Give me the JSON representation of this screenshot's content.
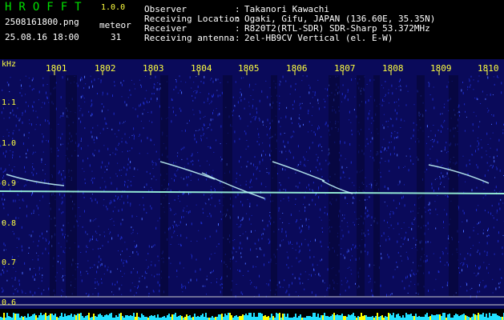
{
  "header": {
    "app_title": "HROFFT",
    "app_version": "1.0.0",
    "file_name": "2508161800.png",
    "meteor_label": "meteor",
    "timestamp": "25.08.16 18:00",
    "meteor_count": "31",
    "info": [
      {
        "key": "Observer",
        "value": "Takanori Kawachi"
      },
      {
        "key": "Receiving Location",
        "value": "Ogaki, Gifu, JAPAN (136.60E, 35.35N)"
      },
      {
        "key": "Receiver",
        "value": "R820T2(RTL-SDR) SDR-Sharp 53.372MHz"
      },
      {
        "key": "Receiving antenna",
        "value": "2el-HB9CV Vertical (el. E-W)"
      }
    ],
    "separator": ":"
  },
  "spectrogram": {
    "y_unit": "kHz",
    "y_ticks": [
      "1.1",
      "1.0",
      "0.9",
      "0.8",
      "0.7",
      "0.6"
    ],
    "x_ticks": [
      "1801",
      "1802",
      "1803",
      "1804",
      "1805",
      "1806",
      "1807",
      "1808",
      "1809",
      "1810"
    ],
    "colors": {
      "background": "#0a0a5a",
      "noise": "#1d2cc8",
      "signal": "#c8ffff",
      "carrier": "#a0ffe0",
      "label": "#ffff40",
      "bar_cyan": "#20e0ff",
      "bar_yellow": "#ffff00"
    }
  }
}
